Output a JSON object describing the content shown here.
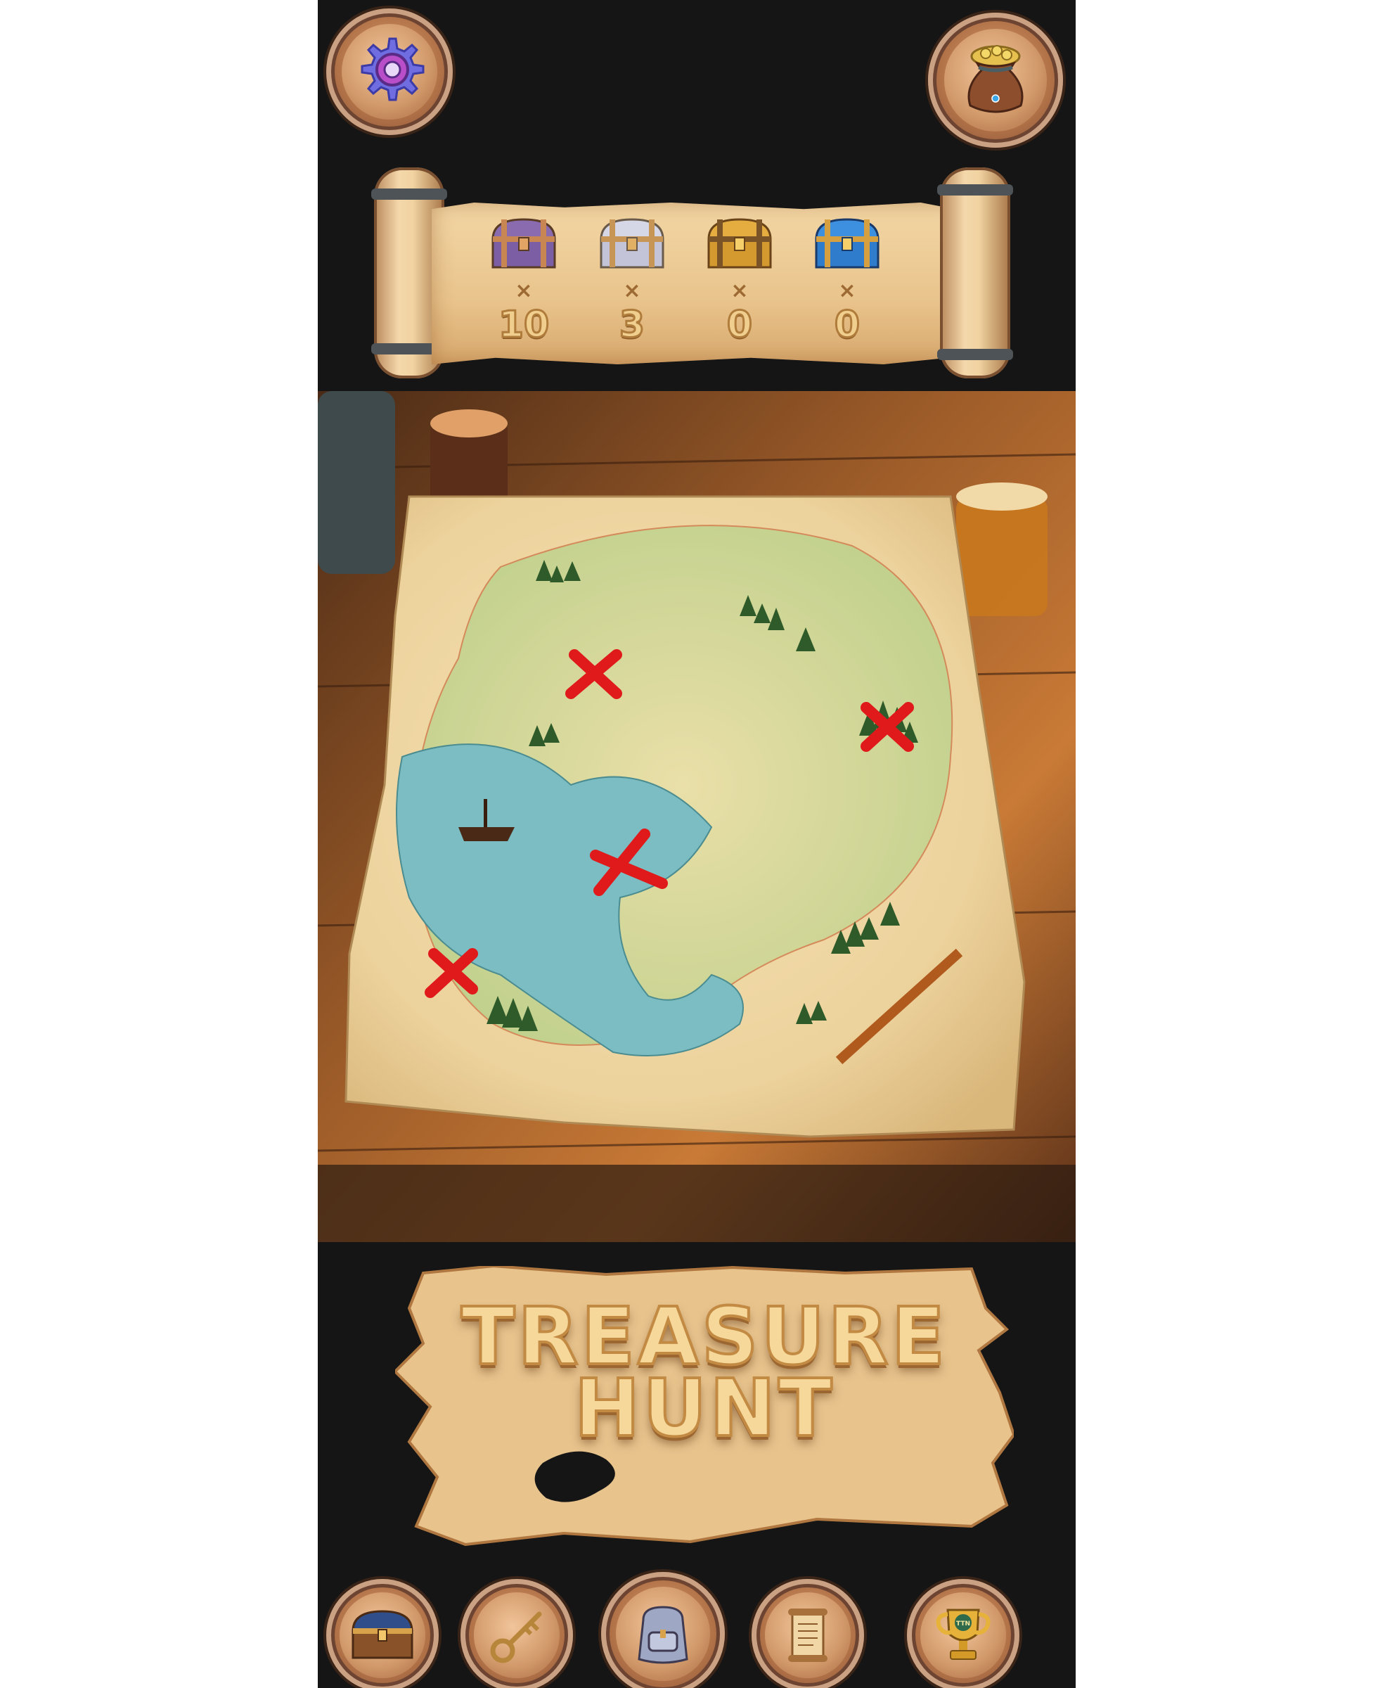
{
  "header": {
    "settings_icon": "gear-icon",
    "inventory_icon": "money-bag-icon"
  },
  "chests": [
    {
      "name": "bronze",
      "icon": "bronze-chest-icon",
      "times": "×",
      "count": "10",
      "color": "#8a6bb0"
    },
    {
      "name": "silver",
      "icon": "silver-chest-icon",
      "times": "×",
      "count": "3",
      "color": "#c9c9d8"
    },
    {
      "name": "gold",
      "icon": "gold-chest-icon",
      "times": "×",
      "count": "0",
      "color": "#e0a838"
    },
    {
      "name": "diamond",
      "icon": "diamond-chest-icon",
      "times": "×",
      "count": "0",
      "color": "#3a8ad8"
    }
  ],
  "map": {
    "scene_icon": "treasure-map-on-table",
    "markers": [
      "x-marker-1",
      "x-marker-2",
      "x-marker-3",
      "x-marker-4"
    ],
    "marker_color": "#e01a1a"
  },
  "banner": {
    "title": "TREASURE\nHUNT"
  },
  "bottom_nav": [
    {
      "id": "chest",
      "icon": "treasure-chest-icon"
    },
    {
      "id": "key",
      "icon": "key-icon"
    },
    {
      "id": "backpack",
      "icon": "backpack-icon"
    },
    {
      "id": "scroll",
      "icon": "scroll-icon"
    },
    {
      "id": "trophy",
      "icon": "trophy-icon",
      "badge_text": "TTN"
    }
  ]
}
